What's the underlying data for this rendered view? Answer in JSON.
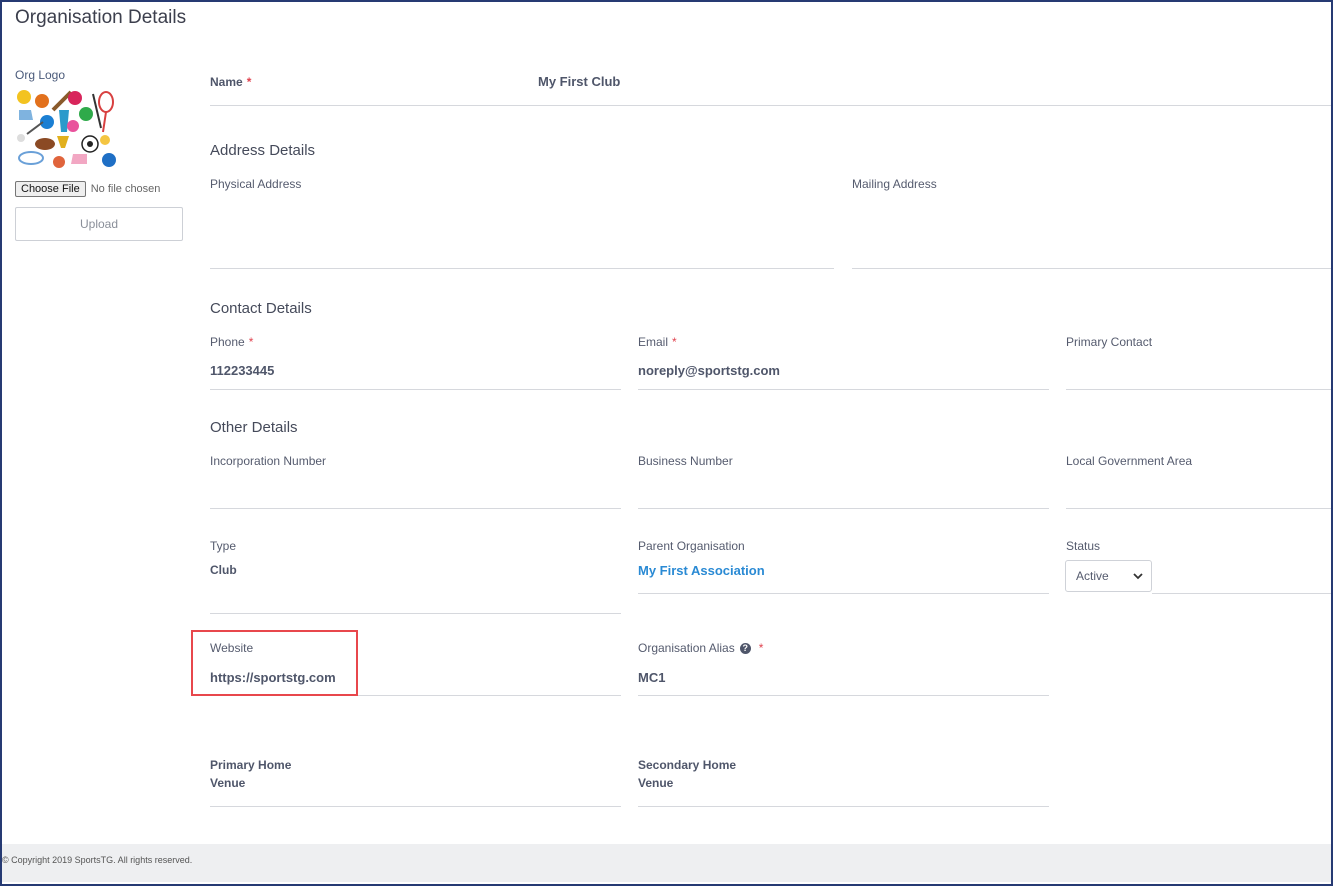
{
  "page": {
    "title": "Organisation Details"
  },
  "sidebar": {
    "logo_label": "Org Logo",
    "choose_file_label": "Choose File",
    "no_file_text": "No file chosen",
    "upload_label": "Upload"
  },
  "name_field": {
    "label": "Name",
    "required_mark": "*",
    "value": "My First Club"
  },
  "address": {
    "heading": "Address Details",
    "physical_label": "Physical Address",
    "mailing_label": "Mailing Address"
  },
  "contact": {
    "heading": "Contact Details",
    "phone_label": "Phone",
    "phone_value": "112233445",
    "email_label": "Email",
    "email_value": "noreply@sportstg.com",
    "primary_contact_label": "Primary Contact",
    "required_mark": "*"
  },
  "other": {
    "heading": "Other Details",
    "incorporation_label": "Incorporation Number",
    "business_label": "Business Number",
    "lga_label": "Local Government Area",
    "type_label": "Type",
    "type_value": "Club",
    "parent_label": "Parent Organisation",
    "parent_value": "My First Association",
    "status_label": "Status",
    "status_value": "Active",
    "website_label": "Website",
    "website_value": "https://sportstg.com",
    "alias_label": "Organisation Alias",
    "alias_value": "MC1",
    "alias_help": "?",
    "required_mark": "*",
    "primary_venue_label": "Primary Home Venue",
    "secondary_venue_label": "Secondary Home Venue"
  },
  "footer": {
    "copyright": "© Copyright 2019 SportsTG. All rights reserved."
  },
  "colors": {
    "accent_link": "#2a8ad4",
    "required": "#e0434f",
    "highlight": "#e8474c",
    "frame": "#263a73"
  }
}
